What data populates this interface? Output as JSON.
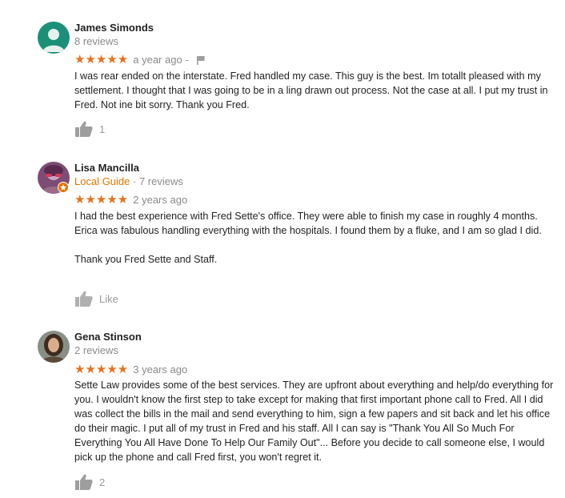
{
  "reviews": [
    {
      "name": "James Simonds",
      "meta": "8 reviews",
      "local_guide": "",
      "stars": "★★★★★",
      "rating": 5,
      "time": "a year ago",
      "separator": "-",
      "text_paragraphs": [
        "I was rear ended on the interstate. Fred handled my case. This guy is the best. Im totallt pleased with my settlement. I thought that I was going to be in a ling drawn out process. Not the case at all. I put my trust in Fred. Not ine bit sorry. Thank you Fred."
      ],
      "like_label": "1",
      "avatar_color": "#1c8f79"
    },
    {
      "name": "Lisa Mancilla",
      "meta": " · 7 reviews",
      "local_guide": "Local Guide",
      "stars": "★★★★★",
      "rating": 5,
      "time": "2 years ago",
      "separator": "",
      "text_paragraphs": [
        "I had the best experience with Fred Sette's office.  They were able to finish my case in roughly 4 months. Erica was fabulous handling everything with the hospitals.  I found them by a fluke, and I am so glad I did.",
        "Thank you Fred Sette and Staff."
      ],
      "like_label": "Like",
      "avatar_color": "#9b6b8a"
    },
    {
      "name": "Gena Stinson",
      "meta": "2 reviews",
      "local_guide": "",
      "stars": "★★★★★",
      "rating": 5,
      "time": "3 years ago",
      "separator": "",
      "text_paragraphs": [
        "Sette Law provides some of the best services.  They are upfront about everything and help/do everything for you.  I wouldn't know the first step to take except for making that first important phone call to Fred.  All I did was collect the bills in the mail and send everything to him, sign a few papers and sit back and let his office do their magic.  I put all of my trust in Fred and his staff.  All I can say is \"Thank You All So Much For Everything You All Have Done To Help Our Family Out\"... Before you decide to call someone else, I would pick up the phone and call Fred first, you won't regret it."
      ],
      "like_label": "2",
      "avatar_color": "#6b5a45"
    }
  ],
  "colors": {
    "star": "#e7711b",
    "local_guide": "#e37400",
    "muted": "#8a8a8a",
    "like": "#999999"
  }
}
